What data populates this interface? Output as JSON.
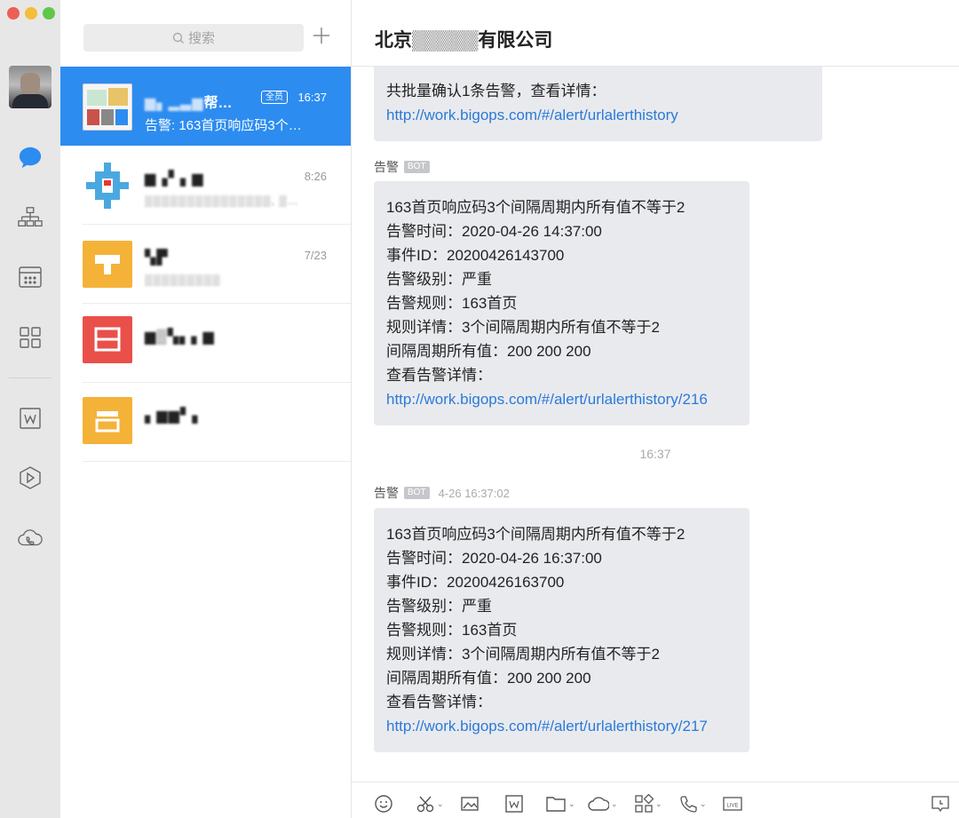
{
  "sidebar": {
    "items": [
      {
        "icon": "chat-bubble-icon",
        "active": true
      },
      {
        "icon": "org-chart-icon"
      },
      {
        "icon": "calendar-icon"
      },
      {
        "icon": "apps-grid-icon"
      },
      {
        "icon": "document-w-icon"
      },
      {
        "icon": "cube-icon"
      },
      {
        "icon": "cloud-call-icon"
      }
    ]
  },
  "search": {
    "placeholder": "搜索"
  },
  "conversations": [
    {
      "name": "帮…",
      "badge": "全员",
      "time": "16:37",
      "preview": "告警: 163首页响应码3个…",
      "active": true
    },
    {
      "name": "▆▗▘▖▆",
      "time": "8:26",
      "preview": "▒▒▒▒▒▒▒▒▒▒▒▒▒▒▒, ▒…"
    },
    {
      "name": "▚▛",
      "time": "7/23",
      "preview": "▒▒▒▒▒▒▒▒▒"
    },
    {
      "name": "▆▒▚▖▖▆",
      "time": "",
      "preview": ""
    },
    {
      "name": "▖▆▆▘▖",
      "time": "",
      "preview": ""
    }
  ],
  "chat": {
    "title": "北京▒▒▒▒▒有限公司",
    "messages": [
      {
        "text": "共批量确认1条告警，查看详情：",
        "link": "http://work.bigops.com/#/alert/urlalerthistory"
      },
      {
        "sender": "告警",
        "bot": "BOT",
        "lines": [
          "163首页响应码3个间隔周期内所有值不等于2",
          "告警时间：2020-04-26 14:37:00",
          "事件ID：20200426143700",
          "告警级别：严重",
          "告警规则：163首页",
          "规则详情：3个间隔周期内所有值不等于2",
          "间隔周期所有值：200 200 200"
        ],
        "link_label": "查看告警详情：",
        "link": "http://work.bigops.com/#/alert/urlalerthistory/216"
      },
      {
        "sender": "告警",
        "bot": "BOT",
        "time": "4-26 16:37:02",
        "lines": [
          "163首页响应码3个间隔周期内所有值不等于2",
          "告警时间：2020-04-26 16:37:00",
          "事件ID：20200426163700",
          "告警级别：严重",
          "告警规则：163首页",
          "规则详情：3个间隔周期内所有值不等于2",
          "间隔周期所有值：200 200 200"
        ],
        "link_label": "查看告警详情：",
        "link": "http://work.bigops.com/#/alert/urlalerthistory/217"
      }
    ],
    "divider_time": "16:37"
  },
  "colors": {
    "accent": "#2d8cf0",
    "link": "#2a7ad8",
    "bubble": "#e9eaee"
  }
}
